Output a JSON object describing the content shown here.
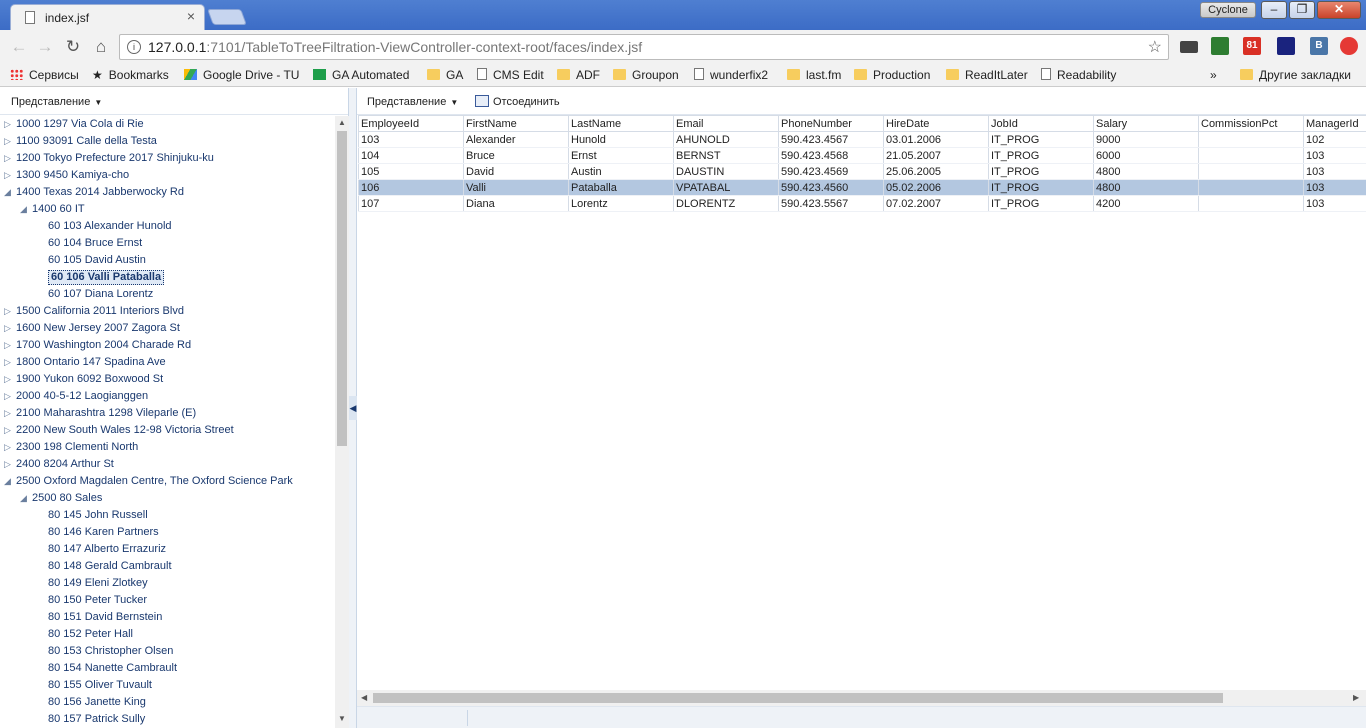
{
  "window": {
    "tab_title": "index.jsf",
    "tab_close": "×",
    "user": "Cyclone",
    "min": "–",
    "max": "❐",
    "close": "✕"
  },
  "toolbar": {
    "url_host": "127.0.0.1",
    "url_rest": ":7101/TableToTreeFiltration-ViewController-context-root/faces/index.jsf"
  },
  "extensions": [
    "ext-a",
    "ext-b",
    "81",
    "ext-d",
    "B",
    "ext-f"
  ],
  "bookmarks": [
    {
      "label": "Сервисы",
      "icon": "apps-icon"
    },
    {
      "label": "Bookmarks",
      "icon": "star-icon"
    },
    {
      "label": "Google Drive - TU",
      "icon": "drive-icon"
    },
    {
      "label": "GA Automated",
      "icon": "sheet-icon"
    },
    {
      "label": "GA",
      "icon": "folder-icon"
    },
    {
      "label": "CMS Edit",
      "icon": "page-icon"
    },
    {
      "label": "ADF",
      "icon": "folder-icon"
    },
    {
      "label": "Groupon",
      "icon": "folder-icon"
    },
    {
      "label": "wunderfix2",
      "icon": "page-icon"
    },
    {
      "label": "last.fm",
      "icon": "folder-icon"
    },
    {
      "label": "Production",
      "icon": "folder-icon"
    },
    {
      "label": "ReadItLater",
      "icon": "folder-icon"
    },
    {
      "label": "Readability",
      "icon": "page-icon"
    }
  ],
  "bookmarks_more": "»",
  "bookmarks_other": "Другие закладки",
  "left_pane": {
    "view_label": "Представление",
    "tree": [
      {
        "level": 0,
        "expanded": false,
        "label": "1000 1297 Via Cola di Rie"
      },
      {
        "level": 0,
        "expanded": false,
        "label": "1100 93091 Calle della Testa"
      },
      {
        "level": 0,
        "expanded": false,
        "label": "1200 Tokyo Prefecture 2017 Shinjuku-ku"
      },
      {
        "level": 0,
        "expanded": false,
        "label": "1300 9450 Kamiya-cho"
      },
      {
        "level": 0,
        "expanded": true,
        "label": "1400 Texas 2014 Jabberwocky Rd"
      },
      {
        "level": 1,
        "expanded": true,
        "label": "1400 60 IT"
      },
      {
        "level": 2,
        "leaf": true,
        "label": "60 103 Alexander Hunold"
      },
      {
        "level": 2,
        "leaf": true,
        "label": "60 104 Bruce Ernst"
      },
      {
        "level": 2,
        "leaf": true,
        "label": "60 105 David Austin"
      },
      {
        "level": 2,
        "leaf": true,
        "selected": true,
        "label": "60 106 Valli Pataballa"
      },
      {
        "level": 2,
        "leaf": true,
        "label": "60 107 Diana Lorentz"
      },
      {
        "level": 0,
        "expanded": false,
        "label": "1500 California 2011 Interiors Blvd"
      },
      {
        "level": 0,
        "expanded": false,
        "label": "1600 New Jersey 2007 Zagora St"
      },
      {
        "level": 0,
        "expanded": false,
        "label": "1700 Washington 2004 Charade Rd"
      },
      {
        "level": 0,
        "expanded": false,
        "label": "1800 Ontario 147 Spadina Ave"
      },
      {
        "level": 0,
        "expanded": false,
        "label": "1900 Yukon 6092 Boxwood St"
      },
      {
        "level": 0,
        "expanded": false,
        "label": "2000 40-5-12 Laogianggen"
      },
      {
        "level": 0,
        "expanded": false,
        "label": "2100 Maharashtra 1298 Vileparle (E)"
      },
      {
        "level": 0,
        "expanded": false,
        "label": "2200 New South Wales 12-98 Victoria Street"
      },
      {
        "level": 0,
        "expanded": false,
        "label": "2300 198 Clementi North"
      },
      {
        "level": 0,
        "expanded": false,
        "label": "2400 8204 Arthur St"
      },
      {
        "level": 0,
        "expanded": true,
        "label": "2500 Oxford Magdalen Centre, The Oxford Science Park"
      },
      {
        "level": 1,
        "expanded": true,
        "label": "2500 80 Sales"
      },
      {
        "level": 2,
        "leaf": true,
        "label": "80 145 John Russell"
      },
      {
        "level": 2,
        "leaf": true,
        "label": "80 146 Karen Partners"
      },
      {
        "level": 2,
        "leaf": true,
        "label": "80 147 Alberto Errazuriz"
      },
      {
        "level": 2,
        "leaf": true,
        "label": "80 148 Gerald Cambrault"
      },
      {
        "level": 2,
        "leaf": true,
        "label": "80 149 Eleni Zlotkey"
      },
      {
        "level": 2,
        "leaf": true,
        "label": "80 150 Peter Tucker"
      },
      {
        "level": 2,
        "leaf": true,
        "label": "80 151 David Bernstein"
      },
      {
        "level": 2,
        "leaf": true,
        "label": "80 152 Peter Hall"
      },
      {
        "level": 2,
        "leaf": true,
        "label": "80 153 Christopher Olsen"
      },
      {
        "level": 2,
        "leaf": true,
        "label": "80 154 Nanette Cambrault"
      },
      {
        "level": 2,
        "leaf": true,
        "label": "80 155 Oliver Tuvault"
      },
      {
        "level": 2,
        "leaf": true,
        "label": "80 156 Janette King"
      },
      {
        "level": 2,
        "leaf": true,
        "label": "80 157 Patrick Sully"
      }
    ]
  },
  "right_pane": {
    "view_label": "Представление",
    "detach_label": "Отсоединить",
    "columns": [
      "EmployeeId",
      "FirstName",
      "LastName",
      "Email",
      "PhoneNumber",
      "HireDate",
      "JobId",
      "Salary",
      "CommissionPct",
      "ManagerId"
    ],
    "rows": [
      {
        "selected": false,
        "cells": [
          "103",
          "Alexander",
          "Hunold",
          "AHUNOLD",
          "590.423.4567",
          "03.01.2006",
          "IT_PROG",
          "9000",
          "",
          "102"
        ]
      },
      {
        "selected": false,
        "cells": [
          "104",
          "Bruce",
          "Ernst",
          "BERNST",
          "590.423.4568",
          "21.05.2007",
          "IT_PROG",
          "6000",
          "",
          "103"
        ]
      },
      {
        "selected": false,
        "cells": [
          "105",
          "David",
          "Austin",
          "DAUSTIN",
          "590.423.4569",
          "25.06.2005",
          "IT_PROG",
          "4800",
          "",
          "103"
        ]
      },
      {
        "selected": true,
        "cells": [
          "106",
          "Valli",
          "Pataballa",
          "VPATABAL",
          "590.423.4560",
          "05.02.2006",
          "IT_PROG",
          "4800",
          "",
          "103"
        ]
      },
      {
        "selected": false,
        "cells": [
          "107",
          "Diana",
          "Lorentz",
          "DLORENTZ",
          "590.423.5567",
          "07.02.2007",
          "IT_PROG",
          "4200",
          "",
          "103"
        ]
      }
    ]
  }
}
